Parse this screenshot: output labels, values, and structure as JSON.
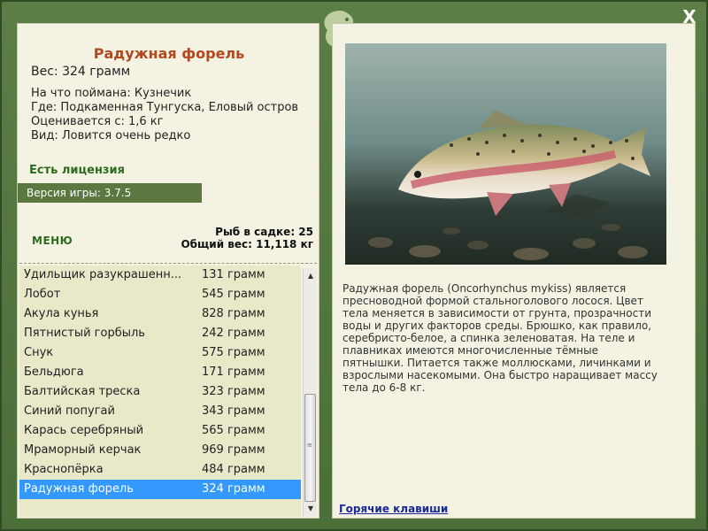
{
  "close_label": "X",
  "fish": {
    "title": "Радужная форель",
    "weight": "Вес: 324 грамм",
    "bait": "На что поймана: Кузнечик",
    "location": "Где: Подкаменная Тунгуска, Еловый остров",
    "value": "Оценивается с: 1,6 кг",
    "rarity": "Вид: Ловится очень редко",
    "description": "Радужная форель (Oncorhynchus mykiss) является пресноводной формой стальноголового лосося. Цвет тела меняется в зависимости от грунта, прозрачности воды и других факторов среды. Брюшко, как правило, серебристо-белое, а спинка зеленоватая. На теле и плавниках имеются многочисленные тёмные пятнышки. Питается также моллюсками, личинками и взрослыми насекомыми. Она быстро наращивает массу тела до 6-8 кг."
  },
  "license": "Есть лицензия",
  "version": "Версия игры: 3.7.5",
  "menu_label": "МЕНЮ",
  "stats": {
    "in_cage": "Рыб в садке: 25",
    "total_weight": "Общий вес: 11,118 кг"
  },
  "catch_list": [
    {
      "name": "Удильщик разукрашенн...",
      "weight": "131 грамм"
    },
    {
      "name": "Лобот",
      "weight": "545 грамм"
    },
    {
      "name": "Акула кунья",
      "weight": "828 грамм"
    },
    {
      "name": "Пятнистый горбыль",
      "weight": "242 грамм"
    },
    {
      "name": "Снук",
      "weight": "575 грамм"
    },
    {
      "name": "Бельдюга",
      "weight": "171 грамм"
    },
    {
      "name": "Балтийская треска",
      "weight": "323 грамм"
    },
    {
      "name": "Синий попугай",
      "weight": "343 грамм"
    },
    {
      "name": "Карась серебряный",
      "weight": "565 грамм"
    },
    {
      "name": "Мраморный керчак",
      "weight": "969 грамм"
    },
    {
      "name": "Краснопёрка",
      "weight": "484 грамм"
    },
    {
      "name": "Радужная форель",
      "weight": "324 грамм",
      "selected": true
    }
  ],
  "hotkeys_link": "Горячие клавиши",
  "icons": {
    "close": "close-icon",
    "logo": "fish-logo-icon",
    "scroll_up": "scroll-up-icon",
    "scroll_down": "scroll-down-icon"
  },
  "colors": {
    "frame": "#4b6f38",
    "panel": "#f4f3e3",
    "title": "#b3471e",
    "license": "#2e6b1c",
    "selection": "#3399ff",
    "link": "#1a2a99"
  }
}
